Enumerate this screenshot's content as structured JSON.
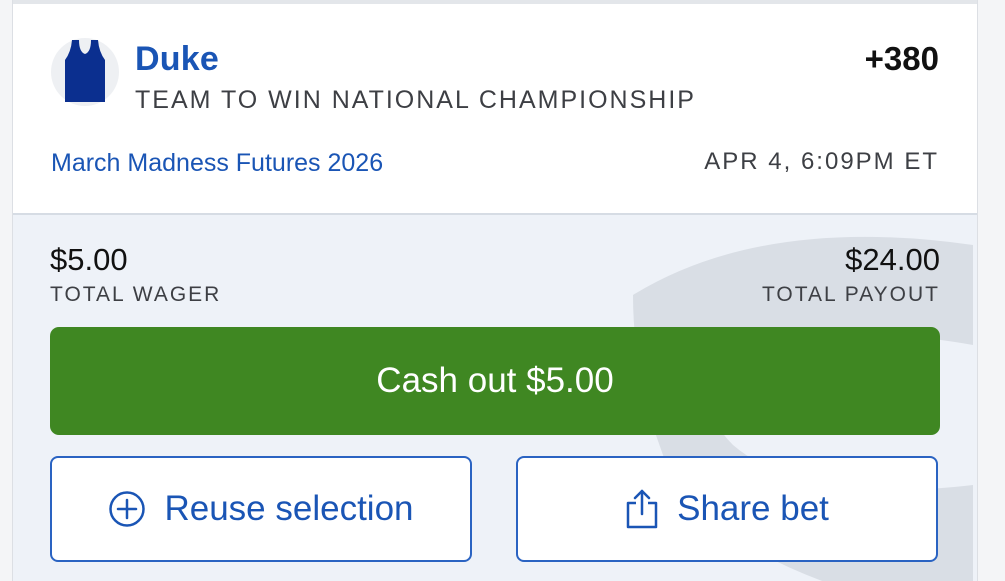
{
  "bet": {
    "team": "Duke",
    "odds": "+380",
    "market": "TEAM TO WIN NATIONAL CHAMPIONSHIP",
    "event": "March Madness Futures 2026",
    "placed_at": "APR 4, 6:09PM ET"
  },
  "wager": {
    "amount": "$5.00",
    "label": "TOTAL WAGER"
  },
  "payout": {
    "amount": "$24.00",
    "label": "TOTAL PAYOUT"
  },
  "actions": {
    "cashout_label": "Cash out $5.00",
    "reuse_label": "Reuse selection",
    "share_label": "Share bet"
  },
  "icons": {
    "team": "jersey-icon",
    "reuse": "plus-circle-icon",
    "share": "share-icon",
    "watermark": "brand-watermark"
  },
  "colors": {
    "accent_blue": "#1a55b5",
    "cashout_green": "#3f8722",
    "jersey_navy": "#0b2f8f"
  }
}
